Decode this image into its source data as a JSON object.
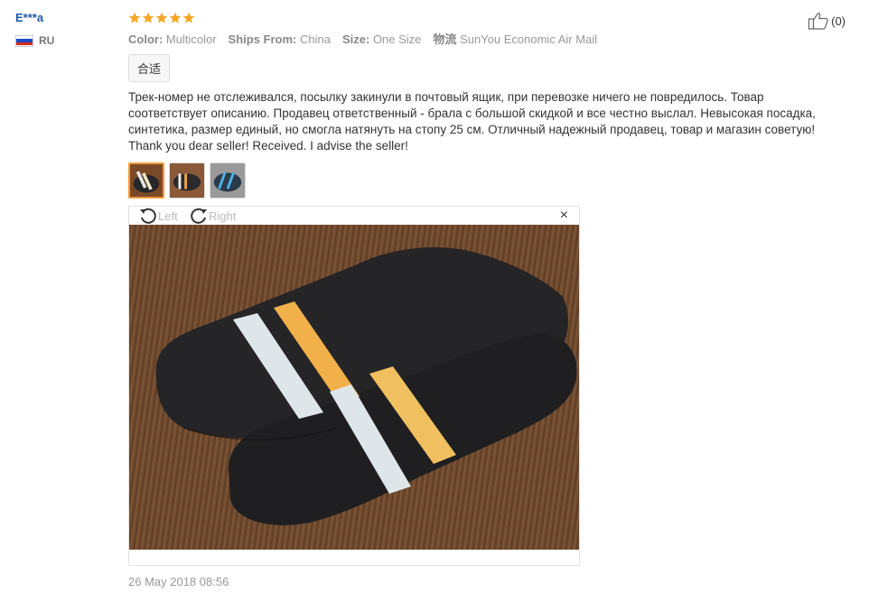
{
  "user": {
    "name": "E***a",
    "country": "RU"
  },
  "rating": {
    "stars": 5
  },
  "helpful": {
    "count": "(0)"
  },
  "attributes": [
    {
      "label": "Color:",
      "value": "Multicolor"
    },
    {
      "label": "Ships From:",
      "value": "China"
    },
    {
      "label": "Size:",
      "value": "One Size"
    },
    {
      "label": "物流",
      "value": "SunYou Economic Air Mail"
    }
  ],
  "tag": "合适",
  "review_text": "Трек-номер не отслеживался, посылку закинули в почтовый ящик, при перевозке ничего не повредилось. Товар соответствует описанию. Продавец ответственный - брала с большой скидкой и все честно выслал. Невысокая посадка, синтетика, размер единый, но смогла натянуть на стопу 25 см. Отличный надежный продавец, товар и магазин советую! Thank you dear seller! Received. I advise the seller!",
  "viewer": {
    "left_label": "Left",
    "right_label": "Right",
    "close": "×"
  },
  "date": "26 May 2018 08:56",
  "colors": {
    "star": "#f5a623",
    "username": "#1f5aa6",
    "active_thumb": "#f29b3d"
  },
  "icons": [
    "thumbs-up-icon",
    "rotate-left-icon",
    "rotate-right-icon",
    "close-icon",
    "star-icon"
  ]
}
